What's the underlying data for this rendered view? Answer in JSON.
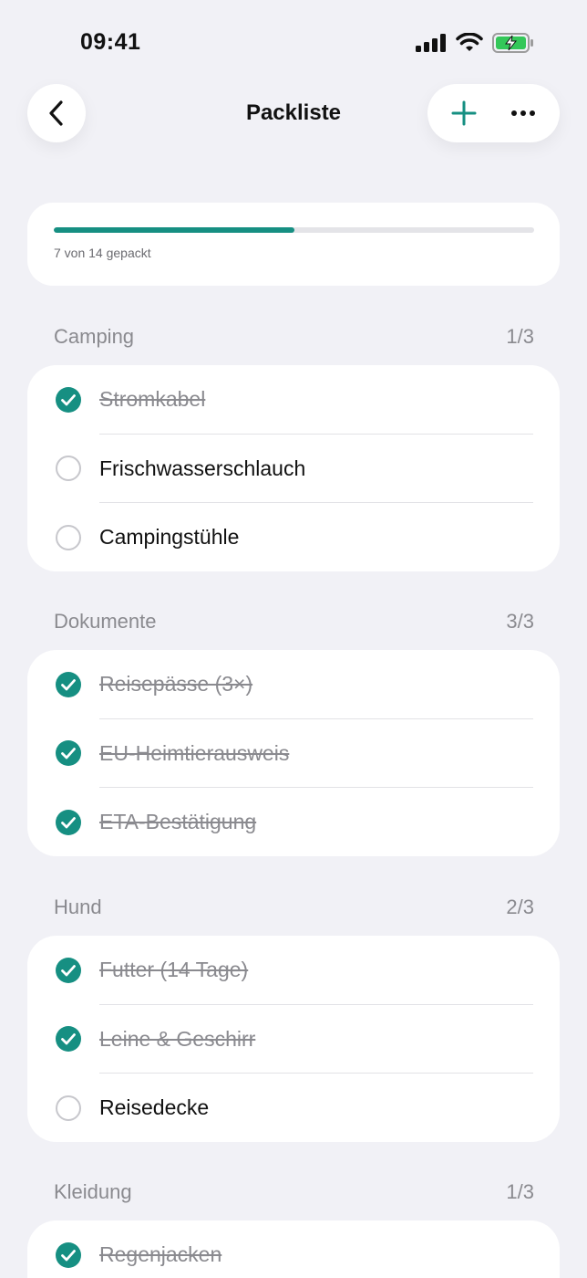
{
  "status": {
    "time": "09:41"
  },
  "nav": {
    "title": "Packliste",
    "back_icon": "chevron-left-icon",
    "add_icon": "plus-icon",
    "more_icon": "ellipsis-icon"
  },
  "progress": {
    "text": "7 von 14 gepackt",
    "fraction": 0.5,
    "color": "#168f82"
  },
  "sections": [
    {
      "title": "Camping",
      "count": "1/3",
      "items": [
        {
          "label": "Stromkabel",
          "done": true
        },
        {
          "label": "Frischwasserschlauch",
          "done": false
        },
        {
          "label": "Campingstühle",
          "done": false
        }
      ]
    },
    {
      "title": "Dokumente",
      "count": "3/3",
      "items": [
        {
          "label": "Reisepässe (3×)",
          "done": true
        },
        {
          "label": "EU-Heimtierausweis",
          "done": true
        },
        {
          "label": "ETA-Bestätigung",
          "done": true
        }
      ]
    },
    {
      "title": "Hund",
      "count": "2/3",
      "items": [
        {
          "label": "Futter (14 Tage)",
          "done": true
        },
        {
          "label": "Leine & Geschirr",
          "done": true
        },
        {
          "label": "Reisedecke",
          "done": false
        }
      ]
    },
    {
      "title": "Kleidung",
      "count": "1/3",
      "items": [
        {
          "label": "Regenjacken",
          "done": true
        }
      ]
    }
  ]
}
